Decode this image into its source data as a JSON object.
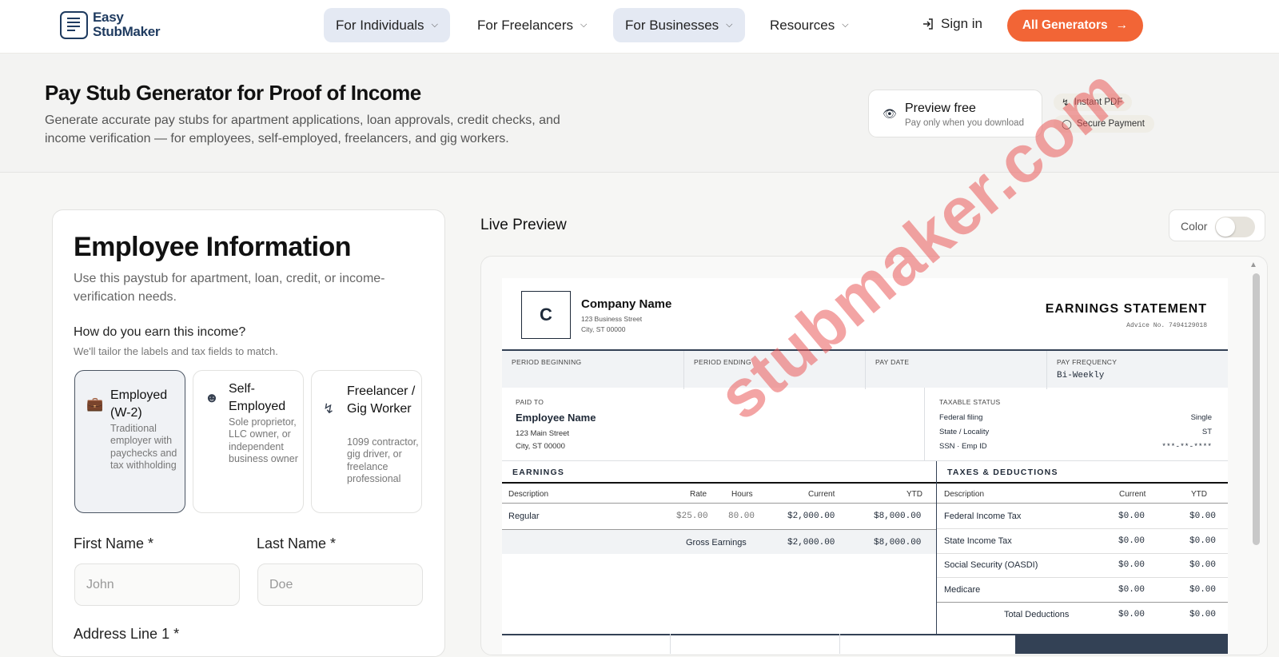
{
  "nav": {
    "logo_line1": "Easy",
    "logo_line2": "StubMaker",
    "items": [
      "For Individuals",
      "For Freelancers",
      "For Businesses",
      "Resources"
    ],
    "sign_in": "Sign in",
    "all_generators": "All Generators"
  },
  "hero": {
    "title": "Pay Stub Generator for Proof of Income",
    "subtitle": "Generate accurate pay stubs for apartment applications, loan approvals, credit checks, and income verification — for employees, self-employed, freelancers, and gig workers.",
    "preview_title": "Preview free",
    "preview_sub": "Pay only when you download",
    "badges": [
      "Instant PDF",
      "Secure Payment"
    ]
  },
  "form": {
    "title": "Employee Information",
    "description": "Use this paystub for apartment, loan, credit, or income-verification needs.",
    "question": "How do you earn this income?",
    "question_hint": "We'll tailor the labels and tax fields to match.",
    "options": [
      {
        "title": "Employed (W-2)",
        "desc": "Traditional employer with paychecks and tax withholding",
        "icon": "briefcase-icon",
        "selected": true
      },
      {
        "title": "Self-Employed",
        "desc": "Sole proprietor, LLC owner, or independent business owner",
        "icon": "person-icon",
        "selected": false
      },
      {
        "title": "Freelancer / Gig Worker",
        "desc": "1099 contractor, gig driver, or freelance professional",
        "icon": "lightning-icon",
        "selected": false
      }
    ],
    "first_name_label": "First Name *",
    "first_name_placeholder": "John",
    "last_name_label": "Last Name *",
    "last_name_placeholder": "Doe",
    "address_label": "Address Line 1 *"
  },
  "preview": {
    "label": "Live Preview",
    "color_label": "Color",
    "color_on": false,
    "stub": {
      "logo_letter": "C",
      "company_name": "Company Name",
      "company_addr1": "123 Business Street",
      "company_addr2": "City, ST 00000",
      "heading": "EARNINGS STATEMENT",
      "advice": "Advice No. 7494129018",
      "period_beginning": "PERIOD BEGINNING",
      "period_ending": "PERIOD ENDING",
      "pay_date": "PAY DATE",
      "pay_frequency_label": "PAY FREQUENCY",
      "pay_frequency": "Bi-Weekly",
      "paid_to_label": "PAID TO",
      "employee_name": "Employee Name",
      "employee_addr1": "123 Main Street",
      "employee_addr2": "City, ST 00000",
      "taxable_status": "TAXABLE STATUS",
      "federal_filing_label": "Federal filing",
      "federal_filing": "Single",
      "state_label": "State / Locality",
      "state": "ST",
      "ssn_label": "SSN · Emp ID",
      "ssn": "***-**-****",
      "earnings_title": "EARNINGS",
      "earn_cols": [
        "Description",
        "Rate",
        "Hours",
        "Current",
        "YTD"
      ],
      "earn_row": [
        "Regular",
        "$25.00",
        "80.00",
        "$2,000.00",
        "$8,000.00"
      ],
      "gross_label": "Gross Earnings",
      "gross_current": "$2,000.00",
      "gross_ytd": "$8,000.00",
      "ded_title": "TAXES & DEDUCTIONS",
      "ded_cols": [
        "Description",
        "Current",
        "YTD"
      ],
      "ded_rows": [
        [
          "Federal Income Tax",
          "$0.00",
          "$0.00"
        ],
        [
          "State Income Tax",
          "$0.00",
          "$0.00"
        ],
        [
          "Social Security (OASDI)",
          "$0.00",
          "$0.00"
        ],
        [
          "Medicare",
          "$0.00",
          "$0.00"
        ]
      ],
      "total_ded_label": "Total Deductions",
      "total_ded_current": "$0.00",
      "total_ded_ytd": "$0.00",
      "watermark": "stubmaker.com"
    }
  }
}
